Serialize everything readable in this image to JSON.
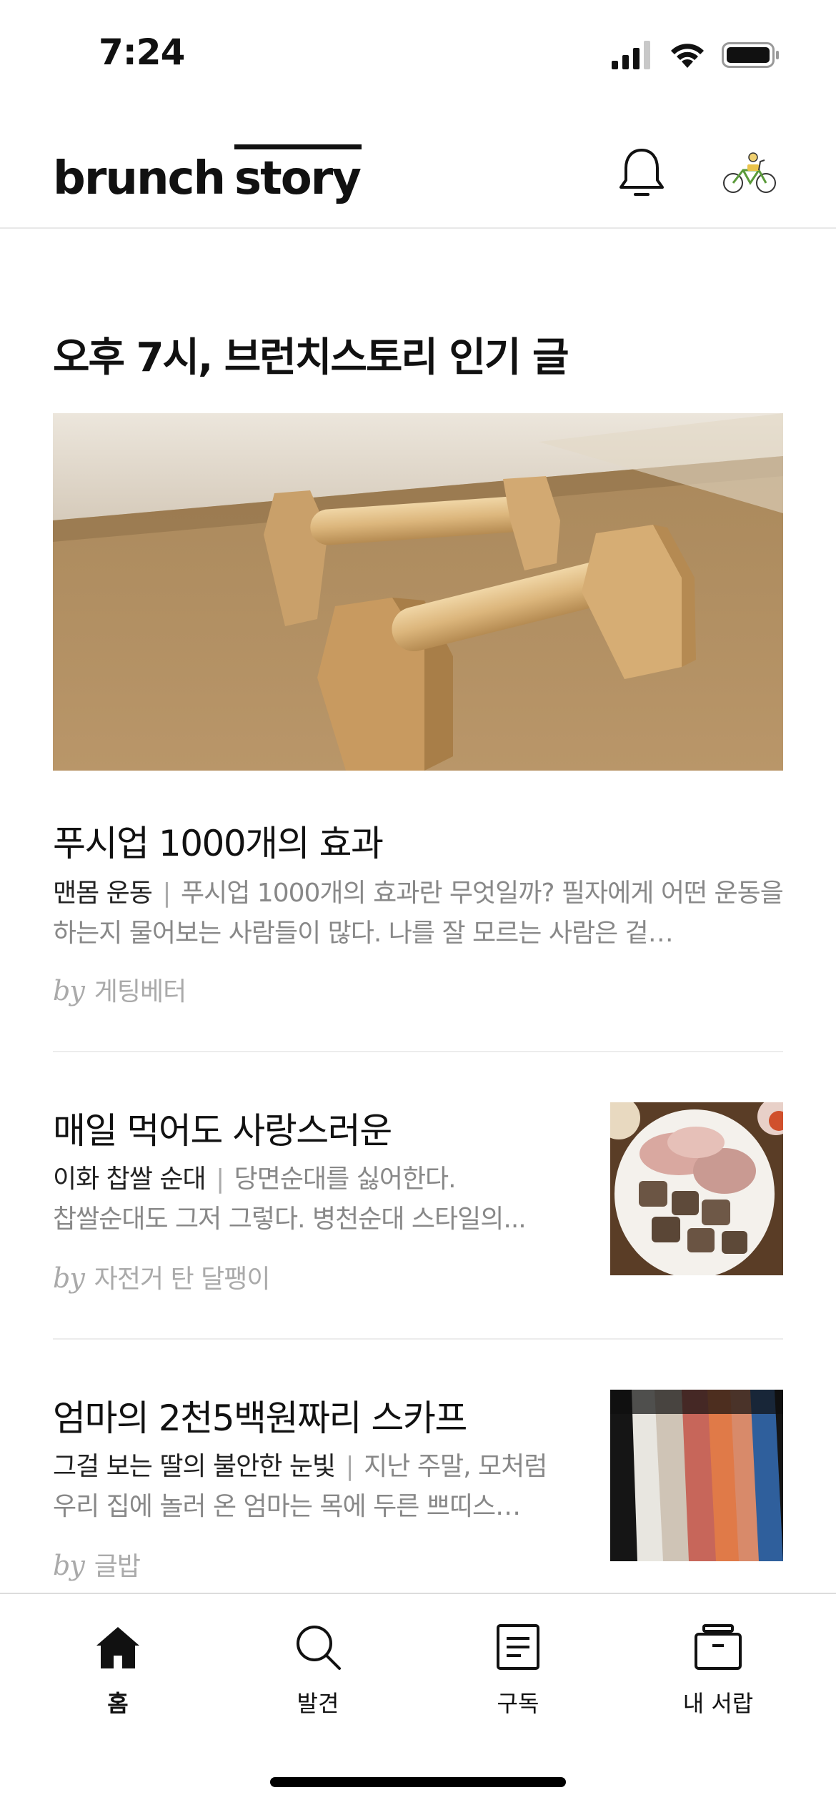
{
  "status_bar": {
    "time": "7:24"
  },
  "header": {
    "logo_part1": "brunch",
    "logo_part2": "story"
  },
  "section": {
    "title": "오후 7시, 브런치스토리 인기 글"
  },
  "featured": {
    "title": "푸시업 1000개의 효과",
    "subtitle": "맨몸 운동",
    "separator": "|",
    "description": "푸시업 1000개의 효과란 무엇일까? 필자에게 어떤 운동을 하는지 물어보는 사람들이 많다. 나를 잘 모르는 사람은 겉…",
    "by": "by",
    "author": "게팅베터"
  },
  "articles": [
    {
      "title": "매일 먹어도 사랑스러운",
      "subtitle": "이화 찹쌀 순대",
      "separator": "|",
      "description_line1": "당면순대를 싫어한다.",
      "description_line2": "찹쌀순대도 그저 그렇다. 병천순대 스타일의...",
      "by": "by",
      "author": "자전거 탄 달팽이"
    },
    {
      "title": "엄마의 2천5백원짜리 스카프",
      "subtitle": "그걸 보는 딸의 불안한 눈빛",
      "separator": "|",
      "description": "지난 주말, 모처럼 우리 집에 놀러 온 엄마는 목에 두른 쁘띠스…",
      "by": "by",
      "author": "글밥"
    }
  ],
  "bottom_nav": [
    {
      "label": "홈",
      "icon": "home-icon",
      "active": true
    },
    {
      "label": "발견",
      "icon": "search-icon",
      "active": false
    },
    {
      "label": "구독",
      "icon": "document-icon",
      "active": false
    },
    {
      "label": "내 서랍",
      "icon": "drawer-icon",
      "active": false
    }
  ],
  "colors": {
    "text": "#111111",
    "muted": "#888888",
    "byline": "#aaaaaa",
    "divider": "#ececec"
  }
}
